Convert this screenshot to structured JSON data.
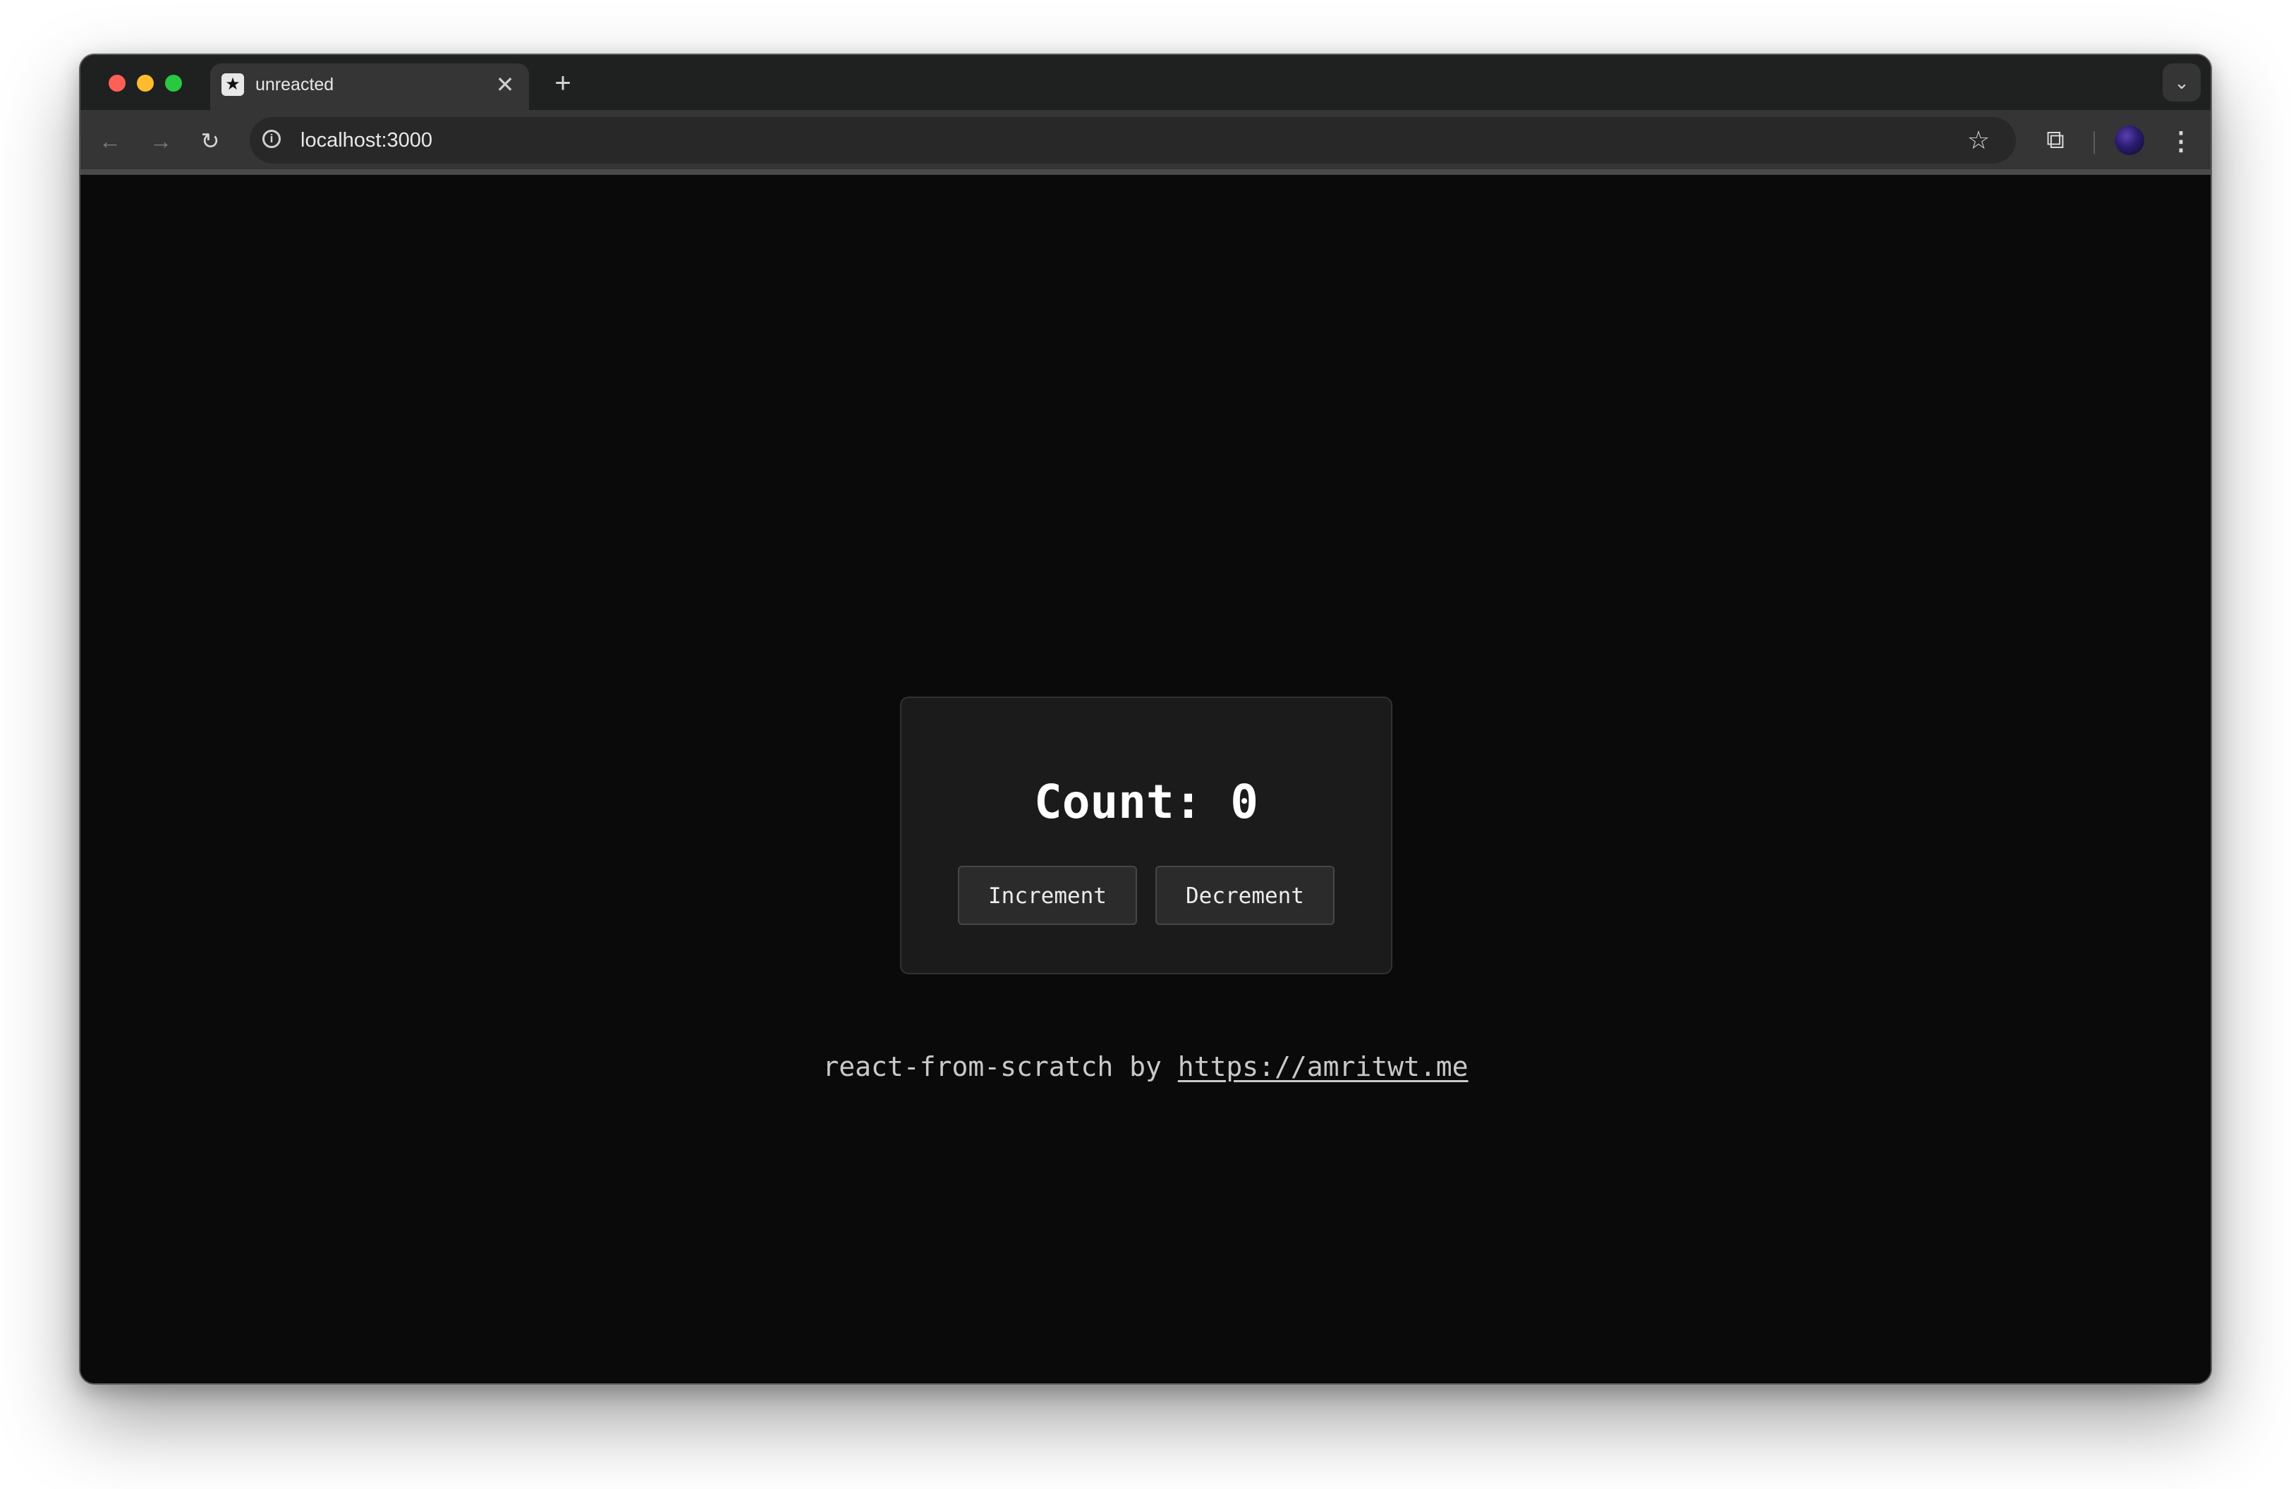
{
  "browser": {
    "tab": {
      "title": "unreacted",
      "favicon_glyph": "★",
      "close_glyph": "✕"
    },
    "new_tab_glyph": "+",
    "tab_dropdown_glyph": "⌄",
    "nav": {
      "back_glyph": "←",
      "forward_glyph": "→",
      "reload_glyph": "↻"
    },
    "address_bar": {
      "url": "localhost:3000",
      "info_glyph": "i"
    },
    "bookmark_glyph": "☆",
    "extensions_glyph": "⧉",
    "menu_glyph": "⋮"
  },
  "page": {
    "count_label": "Count: 0",
    "increment_label": "Increment",
    "decrement_label": "Decrement",
    "footer_text": "react-from-scratch by ",
    "footer_link_text": "https://amritwt.me",
    "footer_link_href": "https://amritwt.me"
  }
}
